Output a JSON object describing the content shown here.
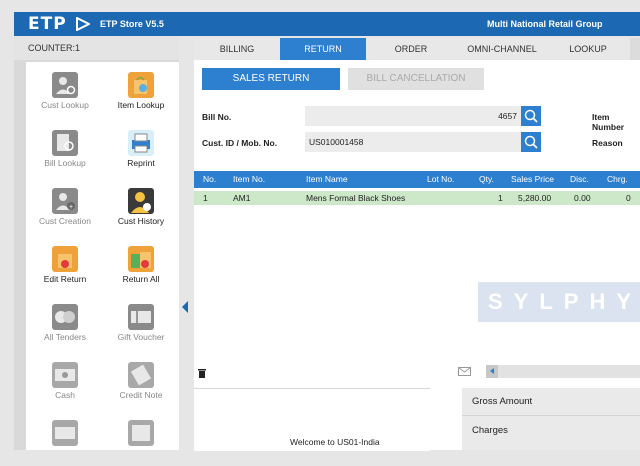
{
  "header": {
    "logo_text": "ETP",
    "app_name": "ETP Store V5.5",
    "company": "Multi National Retail Group"
  },
  "counter": {
    "label": "COUNTER:1"
  },
  "left_buttons": [
    {
      "label": "Cust Lookup",
      "enabled": false,
      "icon": "customer-search-icon"
    },
    {
      "label": "Item Lookup",
      "enabled": true,
      "icon": "bag-search-icon"
    },
    {
      "label": "Bill Lookup",
      "enabled": false,
      "icon": "bill-search-icon"
    },
    {
      "label": "Reprint",
      "enabled": true,
      "icon": "printer-icon"
    },
    {
      "label": "Cust Creation",
      "enabled": false,
      "icon": "add-customer-icon"
    },
    {
      "label": "Cust History",
      "enabled": true,
      "icon": "customer-history-icon"
    },
    {
      "label": "Edit Return",
      "enabled": true,
      "icon": "return-bag-icon"
    },
    {
      "label": "Return All",
      "enabled": true,
      "icon": "return-all-icon"
    },
    {
      "label": "All Tenders",
      "enabled": false,
      "icon": "coins-icon"
    },
    {
      "label": "Gift Voucher",
      "enabled": false,
      "icon": "gift-voucher-icon"
    },
    {
      "label": "Cash",
      "enabled": false,
      "icon": "cash-icon"
    },
    {
      "label": "Credit Note",
      "enabled": false,
      "icon": "credit-note-icon"
    },
    {
      "label": "",
      "enabled": false,
      "icon": "card-icon"
    },
    {
      "label": "",
      "enabled": false,
      "icon": "card-reader-icon"
    }
  ],
  "tabs": [
    "BILLING",
    "RETURN",
    "ORDER",
    "OMNI-CHANNEL",
    "LOOKUP"
  ],
  "active_tab": "RETURN",
  "subtabs": [
    "SALES RETURN",
    "BILL CANCELLATION"
  ],
  "form": {
    "bill_no_label": "Bill No.",
    "bill_no_value": "4657",
    "cust_label": "Cust. ID / Mob. No.",
    "cust_value": "US010001458",
    "item_number_label": "Item Number",
    "reason_label": "Reason"
  },
  "grid": {
    "columns": [
      "No.",
      "Item No.",
      "Item Name",
      "Lot No.",
      "Qty.",
      "Sales Price",
      "Disc.",
      "Chrg."
    ],
    "rows": [
      {
        "no": "1",
        "item_no": "AM1",
        "item_name": "Mens Formal Black Shoes",
        "lot_no": "",
        "qty": "1",
        "sales_price": "5,280.00",
        "disc": "0.00",
        "chrg": "0"
      }
    ]
  },
  "watermark": "SYLPHY",
  "welcome": "Welcome to US01-India",
  "summary": {
    "gross_label": "Gross Amount",
    "charges_label": "Charges"
  },
  "colors": {
    "brand": "#1c68b2",
    "tab_active": "#2d7fcf",
    "row_highlight": "#cde8c9"
  }
}
